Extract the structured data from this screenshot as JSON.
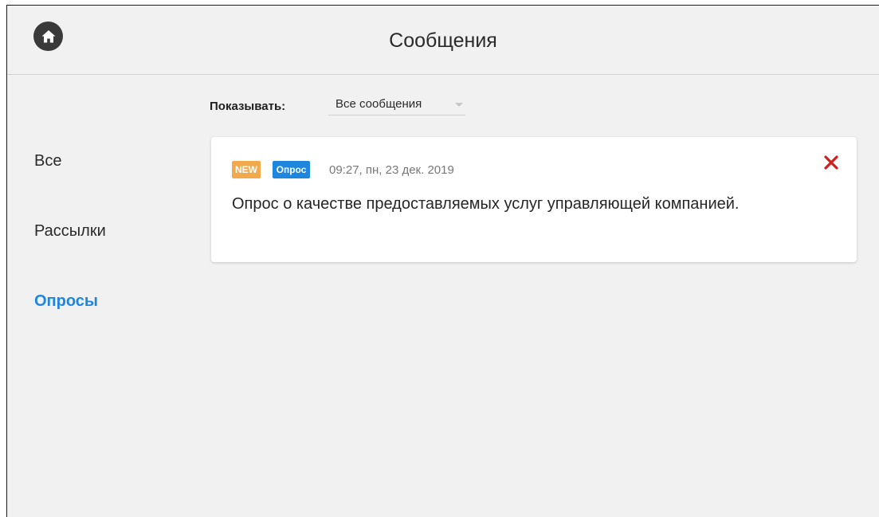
{
  "header": {
    "title": "Сообщения",
    "home_icon": "home-icon"
  },
  "sidebar": {
    "items": [
      {
        "label": "Все",
        "active": false
      },
      {
        "label": "Рассылки",
        "active": false
      },
      {
        "label": "Опросы",
        "active": true
      }
    ],
    "active_color": "#1f86e0"
  },
  "filter": {
    "label": "Показывать:",
    "selected": "Все сообщения"
  },
  "messages": [
    {
      "badge_new": "NEW",
      "badge_type": "Опрос",
      "timestamp": "09:27, пн, 23 дек. 2019",
      "text": "Опрос о качестве предоставляемых услуг управляющей компанией.",
      "close_icon": "close-icon"
    }
  ],
  "colors": {
    "badge_new": "#f2a94a",
    "badge_type": "#1f86e0",
    "close": "#d11e1e"
  }
}
